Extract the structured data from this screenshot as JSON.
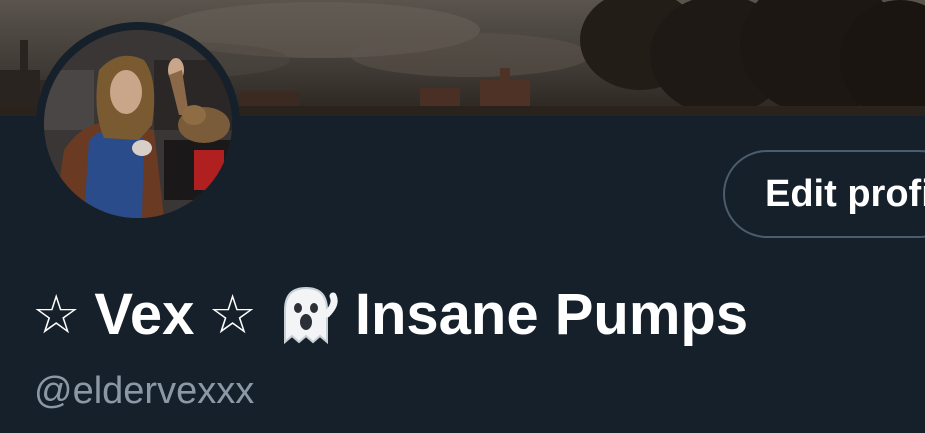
{
  "profile": {
    "display_name_parts": [
      "☆",
      "Vex",
      "☆",
      "Insane Pumps"
    ],
    "ghost_icon": "ghost-emoji-icon",
    "handle": "@eldervexxx"
  },
  "actions": {
    "edit_profile_label": "Edit profile"
  },
  "colors": {
    "background": "#16202b",
    "text_primary": "#ffffff",
    "text_secondary": "#8b98a5",
    "button_border": "#4b5c6c"
  }
}
